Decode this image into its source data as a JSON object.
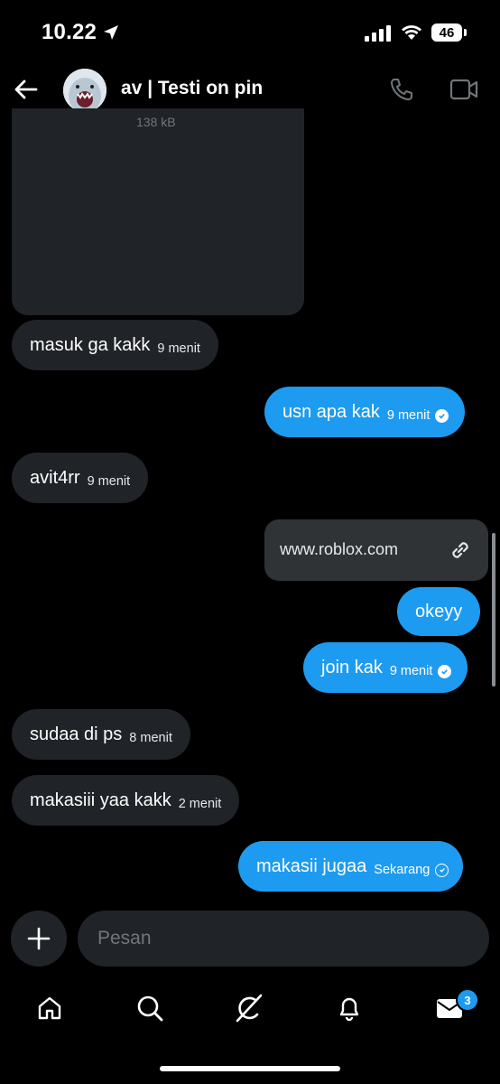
{
  "status_bar": {
    "time": "10.22",
    "battery": "46"
  },
  "header": {
    "title": "av | Testi on pin"
  },
  "media": {
    "size": "138 kB"
  },
  "messages": [
    {
      "text": "masuk ga kakk",
      "time": "9 menit"
    },
    {
      "text": "usn apa kak",
      "time": "9 menit"
    },
    {
      "text": "avit4rr",
      "time": "9 menit"
    },
    {
      "link": "www.roblox.com"
    },
    {
      "text": "okeyy"
    },
    {
      "text": "join kak",
      "time": "9 menit"
    },
    {
      "text": "sudaa di ps",
      "time": "8 menit"
    },
    {
      "text": "makasiii yaa kakk",
      "time": "2 menit"
    },
    {
      "text": "makasii jugaa",
      "time": "Sekarang"
    }
  ],
  "composer": {
    "placeholder": "Pesan"
  },
  "tabs": {
    "messages_badge": "3"
  },
  "colors": {
    "accent": "#1d9bf0",
    "incoming_bubble": "#202327",
    "background": "#000000"
  },
  "icons": [
    "back-arrow-icon",
    "phone-icon",
    "video-icon",
    "link-icon",
    "plus-icon",
    "home-icon",
    "search-icon",
    "grok-icon",
    "bell-icon",
    "mail-icon"
  ]
}
